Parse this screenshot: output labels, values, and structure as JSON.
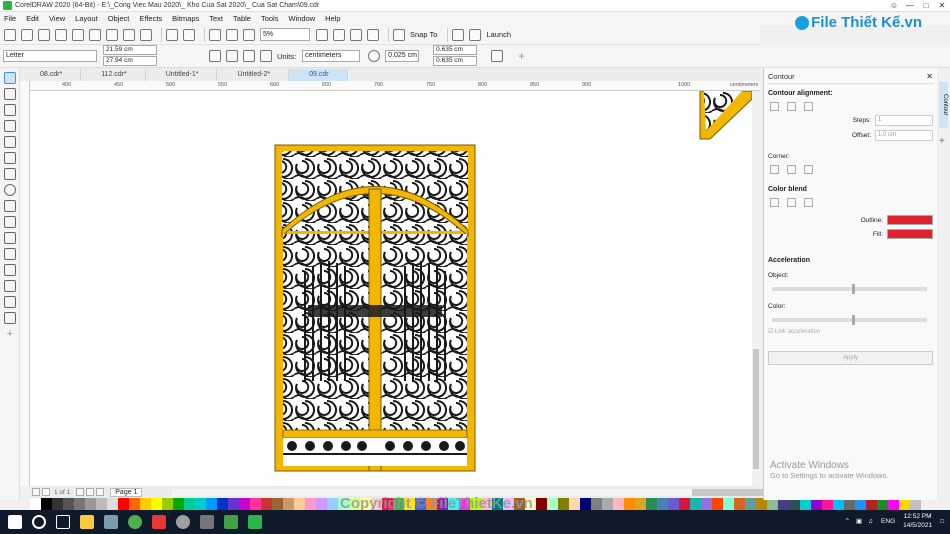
{
  "window": {
    "title": "CorelDRAW 2020 (64-Bit) - E:\\_Cong Viec Mau 2020\\_ Kho Cua Sat 2020\\_ Cua Sat Cham\\09.cdr"
  },
  "menu": [
    "File",
    "Edit",
    "View",
    "Layout",
    "Object",
    "Effects",
    "Bitmaps",
    "Text",
    "Table",
    "Tools",
    "Window",
    "Help"
  ],
  "brand": {
    "text": "File Thiết Kế.vn"
  },
  "toolbar": {
    "zoom": "5%",
    "snap_label": "Snap To",
    "launch_label": "Launch"
  },
  "propbar": {
    "page_size": "Letter",
    "width": "21.59 cm",
    "height": "27.94 cm",
    "units_label": "Units:",
    "units_value": "centimeters",
    "nudge": "0.025 cm",
    "dup_x": "0.635 cm",
    "dup_y": "0.635 cm"
  },
  "tabs": [
    {
      "label": "08.cdr*"
    },
    {
      "label": "112.cdr*"
    },
    {
      "label": "Untitled-1*"
    },
    {
      "label": "Untitled-2*"
    },
    {
      "label": "09.cdr"
    }
  ],
  "ruler": {
    "ticks": [
      "400",
      "450",
      "500",
      "550",
      "600",
      "650",
      "700",
      "750",
      "800",
      "850",
      "900",
      "1000"
    ],
    "unit": "centimeters"
  },
  "pagebar": {
    "page_of": "1 of 1",
    "page_tab": "Page 1"
  },
  "docker": {
    "title": "Contour",
    "contour_alignment": "Contour alignment:",
    "steps_label": "Steps:",
    "steps_value": "1",
    "offset_label": "Offset:",
    "offset_value": "1.0 cm",
    "corner_label": "Corner:",
    "color_blend": "Color blend",
    "outline_label": "Outline:",
    "fill_label": "Fill:",
    "acceleration": "Acceleration",
    "object_label": "Object:",
    "color_label": "Color:",
    "link_accel": "Link acceleration",
    "apply": "Apply",
    "side_tab": "Contour",
    "outline_color": "#e0242f",
    "fill_color": "#e0242f"
  },
  "activate": {
    "line1": "Activate Windows",
    "line2": "Go to Settings to activate Windows."
  },
  "watermark": "Copyright © FileThietKe.vn",
  "taskbar": {
    "lang": "ENG",
    "time": "12:52 PM",
    "date": "14/5/2021"
  },
  "palette": [
    "#ffffff",
    "#000000",
    "#333333",
    "#555555",
    "#777777",
    "#999999",
    "#bbbbbb",
    "#dddddd",
    "#ff0000",
    "#ff6600",
    "#ffcc00",
    "#ffff00",
    "#99cc00",
    "#00aa00",
    "#00cc99",
    "#00cccc",
    "#0099ff",
    "#0033cc",
    "#6633cc",
    "#cc00cc",
    "#ff3399",
    "#cc3333",
    "#996633",
    "#cc9966",
    "#ffcc99",
    "#ff99cc",
    "#cc99ff",
    "#99ccff",
    "#99ffcc",
    "#ccff99",
    "#ffff99",
    "#ffcccc",
    "#e6194b",
    "#3cb44b",
    "#ffe119",
    "#4363d8",
    "#f58231",
    "#911eb4",
    "#46f0f0",
    "#f032e6",
    "#bcf60c",
    "#fabebe",
    "#008080",
    "#e6beff",
    "#9a6324",
    "#fffac8",
    "#800000",
    "#aaffc3",
    "#808000",
    "#ffd8b1",
    "#000075",
    "#808080",
    "#a9a9a9",
    "#ffb6c1",
    "#ff8c00",
    "#daa520",
    "#2e8b57",
    "#4682b4",
    "#6a5acd",
    "#dc143c",
    "#20b2aa",
    "#9370db",
    "#ff4500",
    "#7fffd4",
    "#d2691e",
    "#5f9ea0",
    "#b8860b",
    "#8fbc8f",
    "#483d8b",
    "#2f4f4f",
    "#00ced1",
    "#9400d3",
    "#ff1493",
    "#00bfff",
    "#696969",
    "#1e90ff",
    "#b22222",
    "#228b22",
    "#ff00ff",
    "#ffd700",
    "#c0c0c0"
  ],
  "gate_colors": {
    "frame": "#f2b705",
    "frame_edge": "#7a5a00",
    "iron": "#1a1a1a"
  }
}
